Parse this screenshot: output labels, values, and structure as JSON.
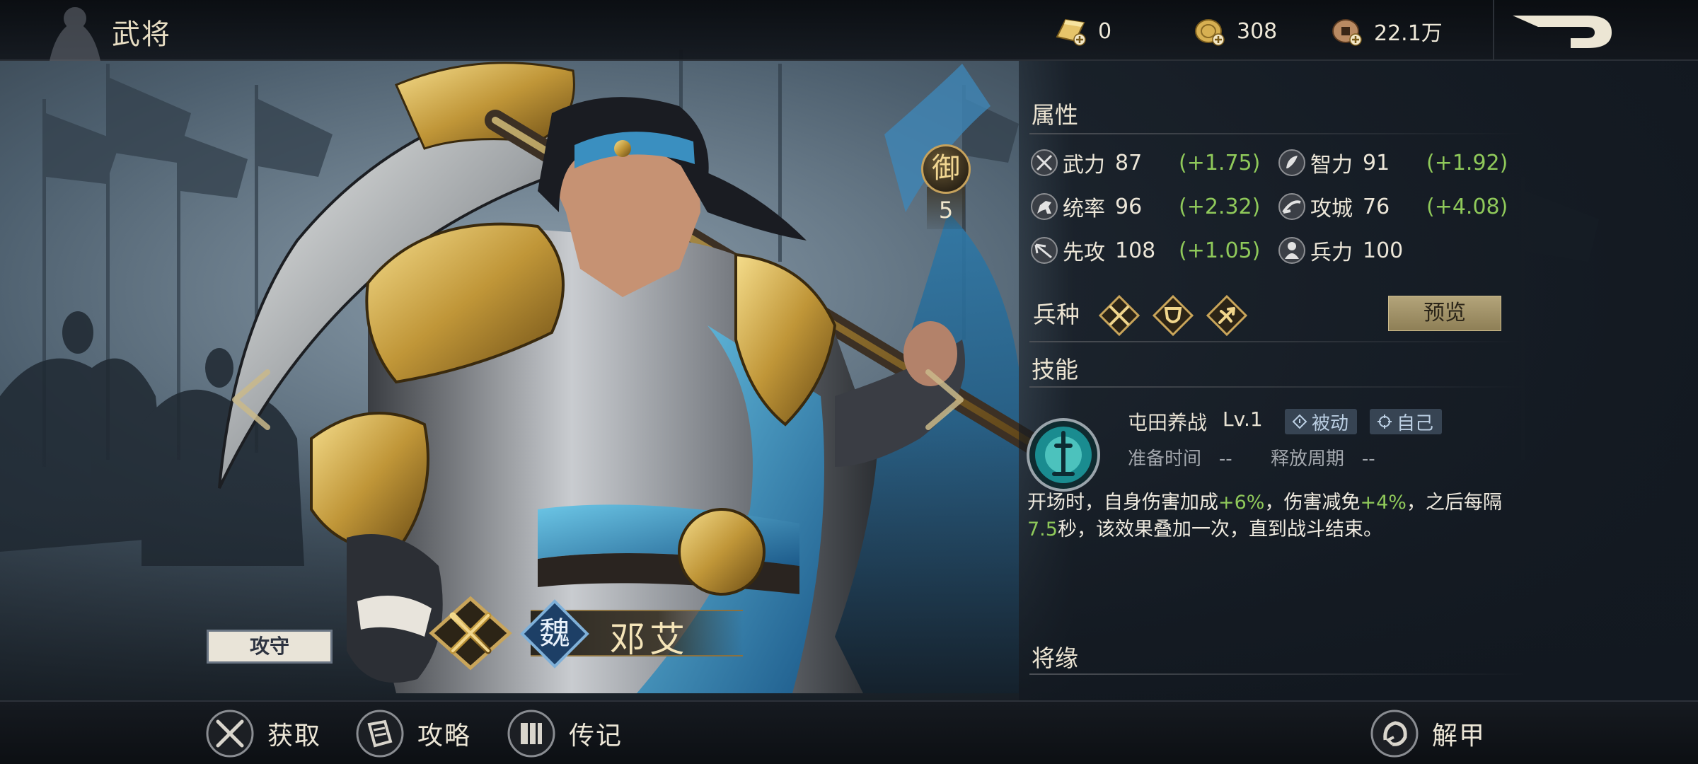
{
  "header": {
    "title": "武将",
    "currencies": [
      {
        "icon": "gold-bar-icon",
        "value": "0"
      },
      {
        "icon": "gold-coin-icon",
        "value": "308"
      },
      {
        "icon": "copper-coin-icon",
        "value": "22.1万"
      }
    ],
    "back_icon": "back-arrow-icon"
  },
  "hero": {
    "name": "邓艾",
    "faction": "魏",
    "role_tag": "攻守",
    "rank_label": "御",
    "rank_value": "5"
  },
  "attributes": {
    "title": "属性",
    "stats": [
      {
        "icon": "sword-icon",
        "label": "武力",
        "value": "87",
        "bonus": "(+1.75)"
      },
      {
        "icon": "intelligence-icon",
        "label": "智力",
        "value": "91",
        "bonus": "(+1.92)"
      },
      {
        "icon": "horse-icon",
        "label": "统率",
        "value": "96",
        "bonus": "(+2.32)"
      },
      {
        "icon": "siege-icon",
        "label": "攻城",
        "value": "76",
        "bonus": "(+4.08)"
      },
      {
        "icon": "speed-icon",
        "label": "先攻",
        "value": "108",
        "bonus": "(+1.05)"
      },
      {
        "icon": "troops-icon",
        "label": "兵力",
        "value": "100",
        "bonus": ""
      }
    ]
  },
  "troop_types": {
    "title": "兵种",
    "icons": [
      "crossed-spears-icon",
      "shield-icon",
      "archer-icon"
    ],
    "preview_label": "预览"
  },
  "skill": {
    "title": "技能",
    "name": "屯田养战",
    "level": "Lv.1",
    "tags": [
      {
        "icon": "diamond-icon",
        "label": "被动"
      },
      {
        "icon": "target-icon",
        "label": "自己"
      }
    ],
    "prep_label": "准备时间",
    "prep_value": "--",
    "cycle_label": "释放周期",
    "cycle_value": "--",
    "desc_parts": [
      "开场时，自身伤害加成",
      "+6%",
      "，伤害减免",
      "+4%",
      "，之后每隔",
      "7.5",
      "秒，该效果叠加一次，直到战斗结束。"
    ]
  },
  "bond": {
    "title": "将缘"
  },
  "bottom_nav": [
    {
      "icon": "swords-icon",
      "label": "获取"
    },
    {
      "icon": "scroll-icon",
      "label": "攻略"
    },
    {
      "icon": "book-icon",
      "label": "传记"
    },
    {
      "icon": "unequip-icon",
      "label": "解甲"
    }
  ],
  "colors": {
    "bonus_green": "#8fc95a",
    "gold": "#c6a25c",
    "panel_bg": "#121820"
  }
}
